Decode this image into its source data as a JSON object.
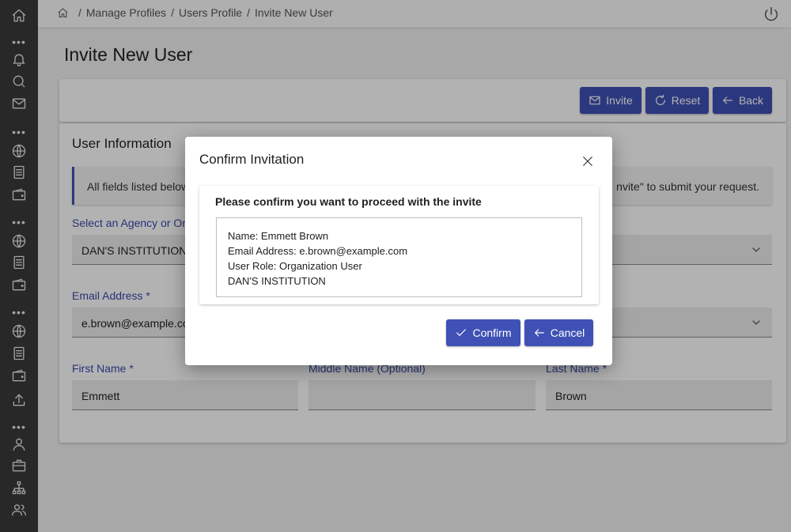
{
  "breadcrumb": {
    "items": [
      "Manage Profiles",
      "Users Profile",
      "Invite New User"
    ]
  },
  "page": {
    "title": "Invite New User"
  },
  "actions": {
    "invite": "Invite",
    "reset": "Reset",
    "back": "Back"
  },
  "user_info": {
    "title": "User Information",
    "notice_start": "All fields listed below",
    "notice_end": "nvite\" to submit your request.",
    "agency_label": "Select an Agency or Org",
    "agency_value": "DAN'S INSTITUTION",
    "email_label": "Email Address  *",
    "email_value": "e.brown@example.co",
    "first_name_label": "First Name  *",
    "first_name_value": "Emmett",
    "middle_name_label": "Middle Name (Optional)",
    "middle_name_value": "",
    "last_name_label": "Last Name  *",
    "last_name_value": "Brown"
  },
  "modal": {
    "title": "Confirm Invitation",
    "message": "Please confirm you want to proceed with the invite",
    "details": [
      "Name: Emmett Brown",
      "Email Address: e.brown@example.com",
      "User Role: Organization User",
      "DAN'S INSTITUTION"
    ],
    "confirm_label": "Confirm",
    "cancel_label": "Cancel"
  },
  "sidebar": {
    "icons": [
      "home-icon",
      "bell-icon",
      "chat-icon",
      "mail-icon",
      "globe-icon",
      "document-icon",
      "wallet-icon",
      "globe-icon",
      "document-icon",
      "wallet-icon",
      "globe-icon",
      "document-icon",
      "wallet-icon",
      "upload-icon",
      "user-icon",
      "briefcase-icon",
      "org-chart-icon",
      "users-icon"
    ]
  },
  "colors": {
    "accent": "#3f51b5",
    "sidebar": "#3a3a3a",
    "label": "#3949ab"
  }
}
